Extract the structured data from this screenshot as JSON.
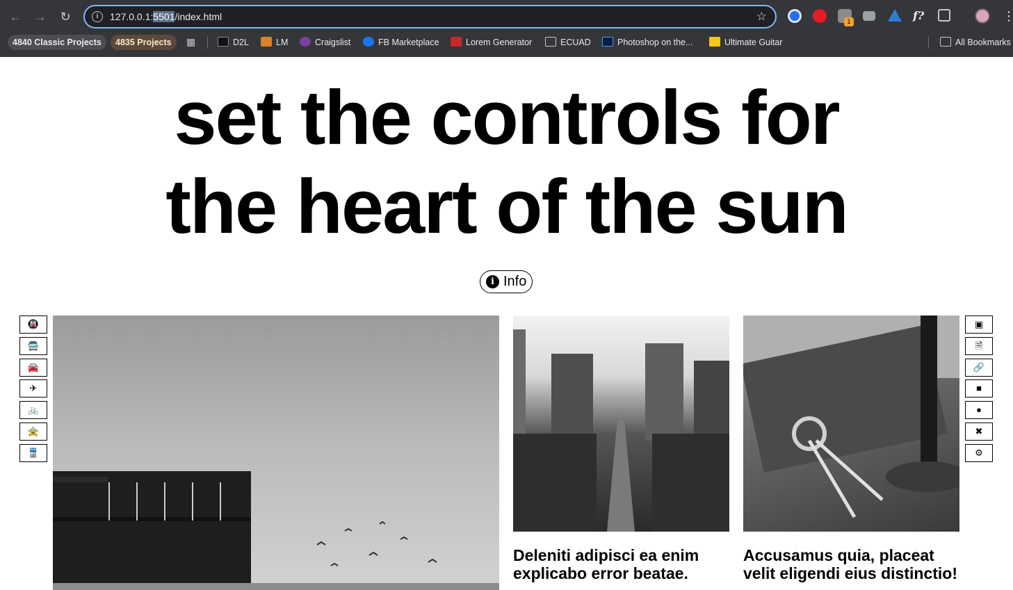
{
  "browser": {
    "url_prefix": "127.0.0.1:",
    "url_selected": "5501",
    "url_suffix": "/index.html",
    "bookmarks": {
      "pill1": "4840 Classic Projects",
      "pill2": "4835 Projects",
      "items": [
        "D2L",
        "LM",
        "Craigslist",
        "FB Marketplace",
        "Lorem Generator",
        "ECUAD",
        "Photoshop on the...",
        "Ultimate Guitar"
      ],
      "all_bookmarks": "All Bookmarks"
    },
    "extension_badge": "1"
  },
  "hero": {
    "line1": "set the controls for",
    "line2": "the heart of the sun"
  },
  "info_button": {
    "label": "Info"
  },
  "left_sidebar_icons": [
    "subway-icon",
    "bus-icon",
    "car-icon",
    "plane-icon",
    "bicycle-icon",
    "taxi-icon",
    "train-icon"
  ],
  "right_sidebar_icons": [
    "images-icon",
    "file-icon",
    "link-icon",
    "comment-icon",
    "user-icon",
    "tools-icon",
    "gear-icon"
  ],
  "cards": [
    {
      "caption": "Deleniti adipisci ea enim explicabo error beatae."
    },
    {
      "caption": "Accusamus quia, placeat velit eligendi eius distinctio!"
    }
  ]
}
